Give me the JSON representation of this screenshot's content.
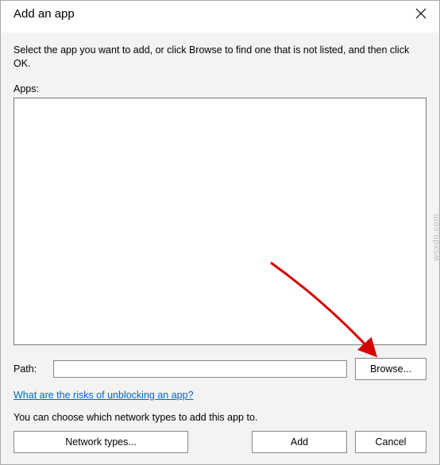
{
  "titlebar": {
    "title": "Add an app"
  },
  "instruction": "Select the app you want to add, or click Browse to find one that is not listed, and then click OK.",
  "apps_label": "Apps:",
  "path": {
    "label": "Path:",
    "value": "",
    "browse_label": "Browse..."
  },
  "risks_link": "What are the risks of unblocking an app?",
  "choose_text": "You can choose which network types to add this app to.",
  "buttons": {
    "network_types": "Network types...",
    "add": "Add",
    "cancel": "Cancel"
  },
  "watermark": "wsxdn.com"
}
